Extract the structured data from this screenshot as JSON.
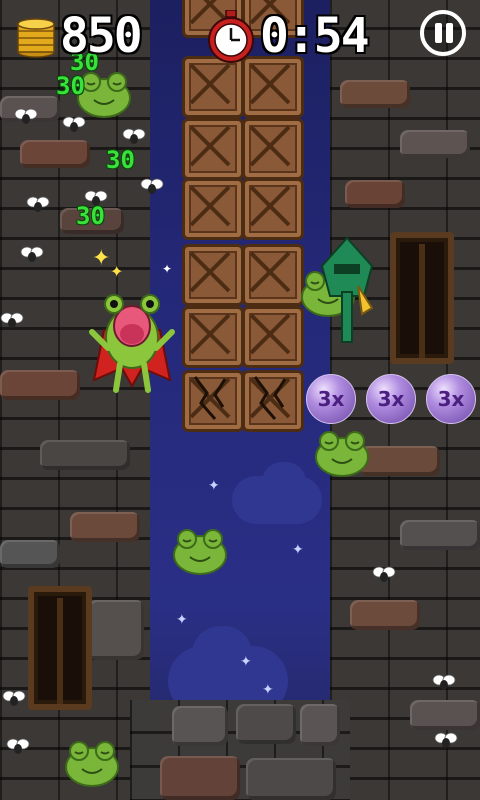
{
  "hud": {
    "coins": "850",
    "timer": "0:54",
    "coins_icon": "coin-stack-icon",
    "timer_icon": "stopwatch-icon",
    "pause_icon": "pause-icon"
  },
  "score_popups": [
    "30",
    "30",
    "30",
    "30"
  ],
  "multipliers": [
    "3x",
    "3x",
    "3x"
  ],
  "colors": {
    "sky": "#25297a",
    "wall": "#3b3836",
    "crate": "#8a5a38",
    "frog_green": "#7dbb3a",
    "score_green": "#39e23a",
    "bubble_purple": "#b18ee0"
  }
}
